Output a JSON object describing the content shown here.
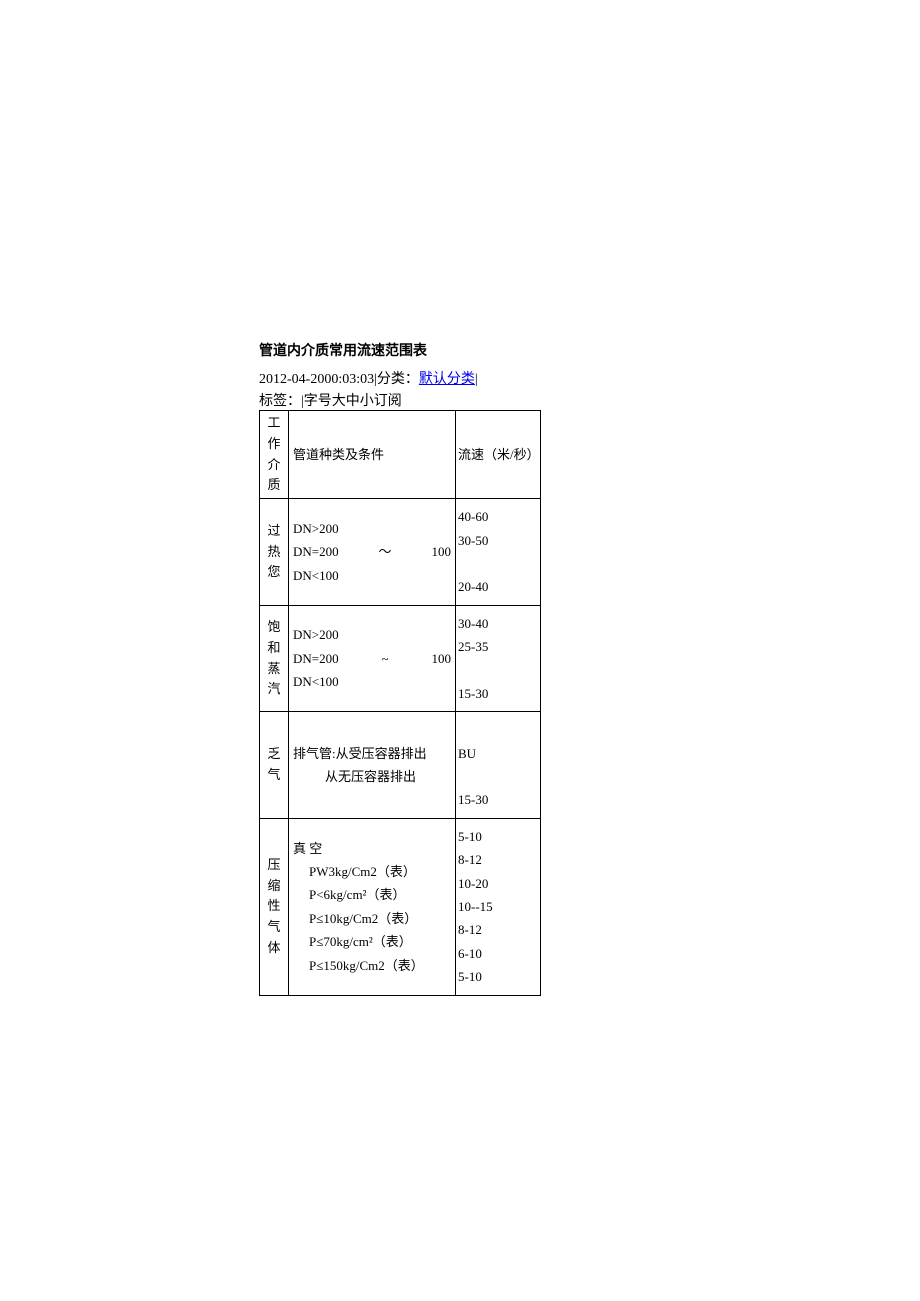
{
  "title": "管道内介质常用流速范围表",
  "meta": {
    "timestamp": "2012-04-2000:03:03",
    "category_prefix": "|分类：",
    "category_link": "默认分类",
    "category_suffix": "|"
  },
  "tags_line": "标签：|字号大中小订阅",
  "header": {
    "col1_c1": "工",
    "col1_c2": "作",
    "col1_c3": "介",
    "col1_c4": "质",
    "col2": "管道种类及条件",
    "col3": "流速（米/秒）"
  },
  "rows": [
    {
      "col1_chars": [
        "过",
        "热",
        "",
        "您",
        ""
      ],
      "col2_lines": [
        {
          "type": "plain",
          "text": "DN>200"
        },
        {
          "type": "spread",
          "left": "DN=200",
          "mid": "～",
          "right": "100"
        },
        {
          "type": "plain",
          "text": "DN<100"
        }
      ],
      "col3_lines": [
        "40-60",
        "30-50",
        "",
        "20-40"
      ]
    },
    {
      "col1_chars": [
        "饱",
        "和",
        "蒸",
        "汽"
      ],
      "col2_lines": [
        {
          "type": "plain",
          "text": "DN>200"
        },
        {
          "type": "spread",
          "left": "DN=200",
          "mid": "~",
          "right": "100"
        },
        {
          "type": "plain",
          "text": "DN<100"
        }
      ],
      "col3_lines": [
        "30-40",
        "25-35",
        "",
        "15-30"
      ]
    },
    {
      "col1_chars": [
        "乏",
        "气"
      ],
      "col2_lines": [
        {
          "type": "plain",
          "text": "排气管:从受压容器排出"
        },
        {
          "type": "indent",
          "text": "从无压容器排出"
        }
      ],
      "col3_lines": [
        "",
        "BU",
        "",
        "15-30"
      ]
    },
    {
      "col1_chars": [
        "",
        "压",
        "缩",
        "性",
        "气",
        "体",
        ""
      ],
      "col2_lines": [
        {
          "type": "plain",
          "text": "真 空"
        },
        {
          "type": "indent2",
          "text": "PW3kg/Cm2（表）"
        },
        {
          "type": "indent2",
          "text": "P<6kg/cm²（表）"
        },
        {
          "type": "indent2",
          "text": "P≤10kg/Cm2（表）"
        },
        {
          "type": "indent2",
          "text": "P≤70kg/cm²（表）"
        },
        {
          "type": "indent2",
          "text": "P≤150kg/Cm2（表）"
        }
      ],
      "col3_lines": [
        "5-10",
        "8-12",
        "10-20",
        "10--15",
        "8-12",
        "6-10",
        "5-10"
      ]
    }
  ]
}
